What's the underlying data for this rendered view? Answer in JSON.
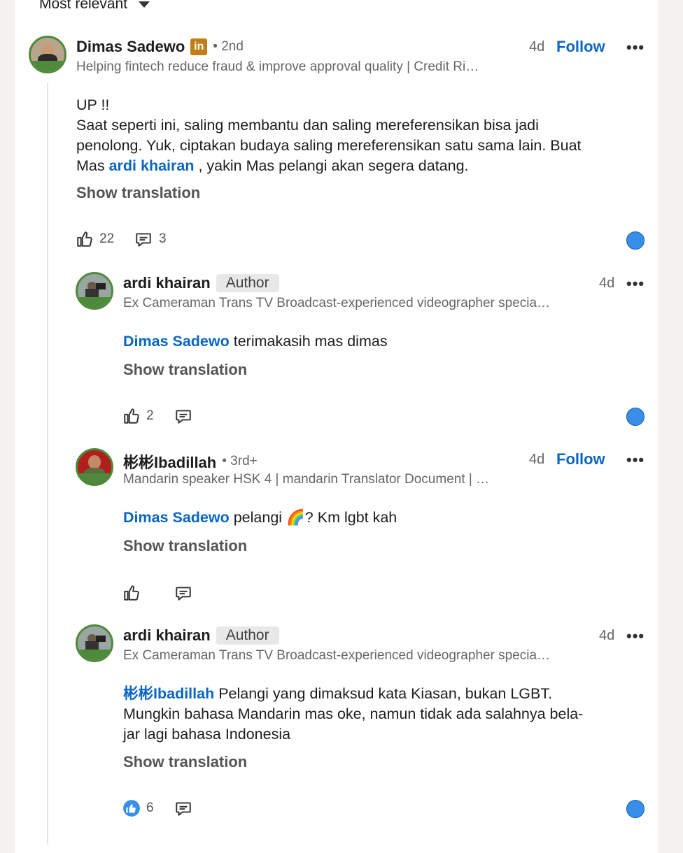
{
  "sort": {
    "label": "Most relevant"
  },
  "comments": [
    {
      "author": "Dimas Sadewo",
      "degree": "• 2nd",
      "headline": "Helping fintech reduce fraud & improve approval quality | Credit Ri…",
      "time": "4d",
      "follow": "Follow",
      "text_line1": "UP !!",
      "text_line2": "Saat seperti ini, saling membantu dan saling mereferensikan bisa jadi",
      "text_line3": "penolong. Yuk, ciptakan budaya saling mereferensikan satu sama lain. Buat",
      "text_line4_pre": "Mas ",
      "text_line4_mention": "ardi khairan",
      "text_line4_post": " , yakin Mas pelangi akan segera datang.",
      "show_translation": "Show translation",
      "likes": "22",
      "replies": "3"
    },
    {
      "author": "ardi khairan",
      "author_tag": "Author",
      "headline": "Ex Cameraman Trans TV Broadcast-experienced videographer specia…",
      "time": "4d",
      "mention": "Dimas Sadewo",
      "text": " terimakasih mas dimas",
      "show_translation": "Show translation",
      "likes": "2"
    },
    {
      "author": "彬彬Ibadillah",
      "degree": "• 3rd+",
      "headline": "Mandarin speaker HSK 4 |  mandarin Translator Document | …",
      "time": "4d",
      "follow": "Follow",
      "mention": "Dimas Sadewo",
      "text": " pelangi 🌈? Km lgbt kah",
      "show_translation": "Show translation"
    },
    {
      "author": "ardi khairan",
      "author_tag": "Author",
      "headline": "Ex Cameraman Trans TV Broadcast-experienced videographer specia…",
      "time": "4d",
      "mention": "彬彬Ibadillah",
      "text_line1": " Pelangi yang dimaksud kata Kiasan, bukan LGBT.",
      "text_line2": "Mungkin bahasa Mandarin mas oke, namun tidak ada salahnya bela-",
      "text_line3": "jar lagi bahasa Indonesia",
      "show_translation": "Show translation",
      "likes": "6"
    }
  ],
  "more_glyph": "•••",
  "colors": {
    "link": "#0a66c2",
    "reaction": "#378fe9",
    "linkedin_badge": "#c37d16"
  }
}
